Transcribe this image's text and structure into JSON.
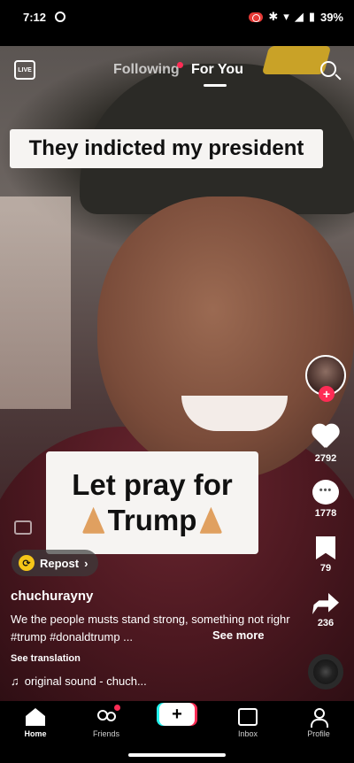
{
  "status_bar": {
    "time": "7:12",
    "battery": "39%"
  },
  "top_nav": {
    "live_label": "LIVE",
    "following": "Following",
    "for_you": "For You"
  },
  "video": {
    "caption_top": "They indicted my president",
    "caption_mid_line1": "Let pray for",
    "caption_mid_line2": "Trump"
  },
  "actions": {
    "likes": "2792",
    "comments": "1778",
    "saves": "79",
    "shares": "236"
  },
  "post": {
    "repost_label": "Repost",
    "username": "chuchurayny",
    "description": "We the people musts stand strong, something not righr #trump #donaldtrump ...",
    "see_more": "See more",
    "see_translation": "See translation",
    "sound": "original sound - chuch..."
  },
  "bottom_nav": {
    "home": "Home",
    "friends": "Friends",
    "inbox": "Inbox",
    "profile": "Profile",
    "create_symbol": "+"
  }
}
